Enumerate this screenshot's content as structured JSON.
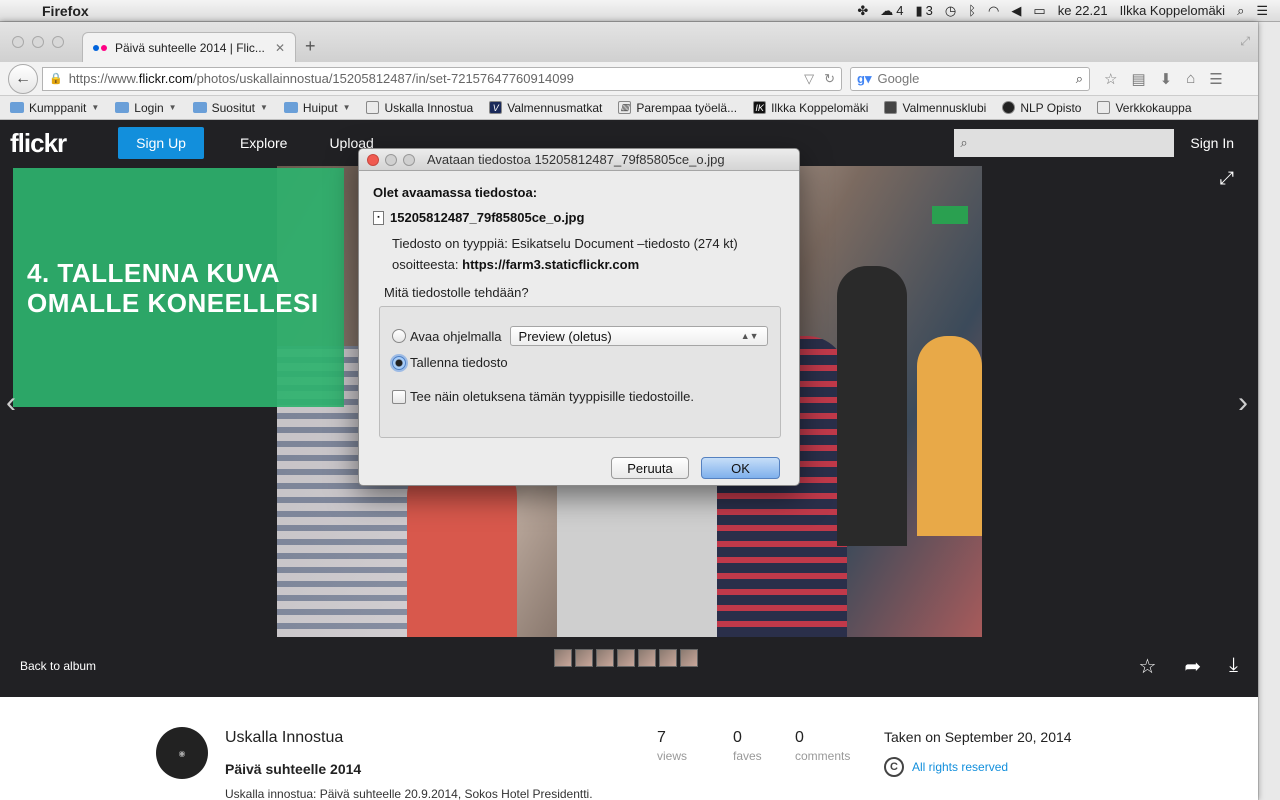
{
  "menubar": {
    "app": "Firefox",
    "status": {
      "dropbox": "",
      "cc_count": "4",
      "adobe_count": "3",
      "time": "ke 22.21",
      "user": "Ilkka Koppelomäki"
    }
  },
  "browser": {
    "tab_title": "Päivä suhteelle 2014 | Flic...",
    "url_prefix": "https://www.",
    "url_host": "flickr.com",
    "url_path": "/photos/uskallainnostua/15205812487/in/set-72157647760914099",
    "search_placeholder": "Google",
    "bookmarks": [
      {
        "label": "Kumppanit",
        "type": "folder"
      },
      {
        "label": "Login",
        "type": "folder"
      },
      {
        "label": "Suositut",
        "type": "folder"
      },
      {
        "label": "Huiput",
        "type": "folder"
      },
      {
        "label": "Uskalla Innostua",
        "type": "page"
      },
      {
        "label": "Valmennusmatkat",
        "type": "page"
      },
      {
        "label": "Parempaa työelä...",
        "type": "page"
      },
      {
        "label": "Ilkka Koppelomäki",
        "type": "page"
      },
      {
        "label": "Valmennusklubi",
        "type": "page"
      },
      {
        "label": "NLP Opisto",
        "type": "page"
      },
      {
        "label": "Verkkokauppa",
        "type": "page"
      }
    ]
  },
  "flickr": {
    "logo": "flickr",
    "signup": "Sign Up",
    "explore": "Explore",
    "upload": "Upload",
    "signin": "Sign In",
    "overlay_text_1": "4. TALLENNA KUVA",
    "overlay_text_2": "OMALLE KONEELLESI",
    "back_to_album": "Back to album",
    "owner": "Uskalla Innostua",
    "photo_title": "Päivä suhteelle 2014",
    "description": "Uskalla innostua: Päivä suhteelle 20.9.2014, Sokos Hotel Presidentti.",
    "stats": [
      {
        "value": "7",
        "label": "views"
      },
      {
        "value": "0",
        "label": "faves"
      },
      {
        "value": "0",
        "label": "comments"
      }
    ],
    "taken": "Taken on September 20, 2014",
    "rights": "All rights reserved"
  },
  "dialog": {
    "title": "Avataan tiedostoa 15205812487_79f85805ce_o.jpg",
    "heading": "Olet avaamassa tiedostoa:",
    "filename": "15205812487_79f85805ce_o.jpg",
    "type_label": "Tiedosto on tyyppiä:",
    "type_value": "Esikatselu Document –tiedosto (274 kt)",
    "from_label": "osoitteesta:",
    "from_value": "https://farm3.staticflickr.com",
    "question": "Mitä tiedostolle tehdään?",
    "open_with_label": "Avaa ohjelmalla",
    "open_with_value": "Preview (oletus)",
    "save_label": "Tallenna tiedosto",
    "default_label": "Tee näin oletuksena tämän tyyppisille tiedostoille.",
    "selected_option": "save",
    "cancel": "Peruuta",
    "ok": "OK"
  }
}
